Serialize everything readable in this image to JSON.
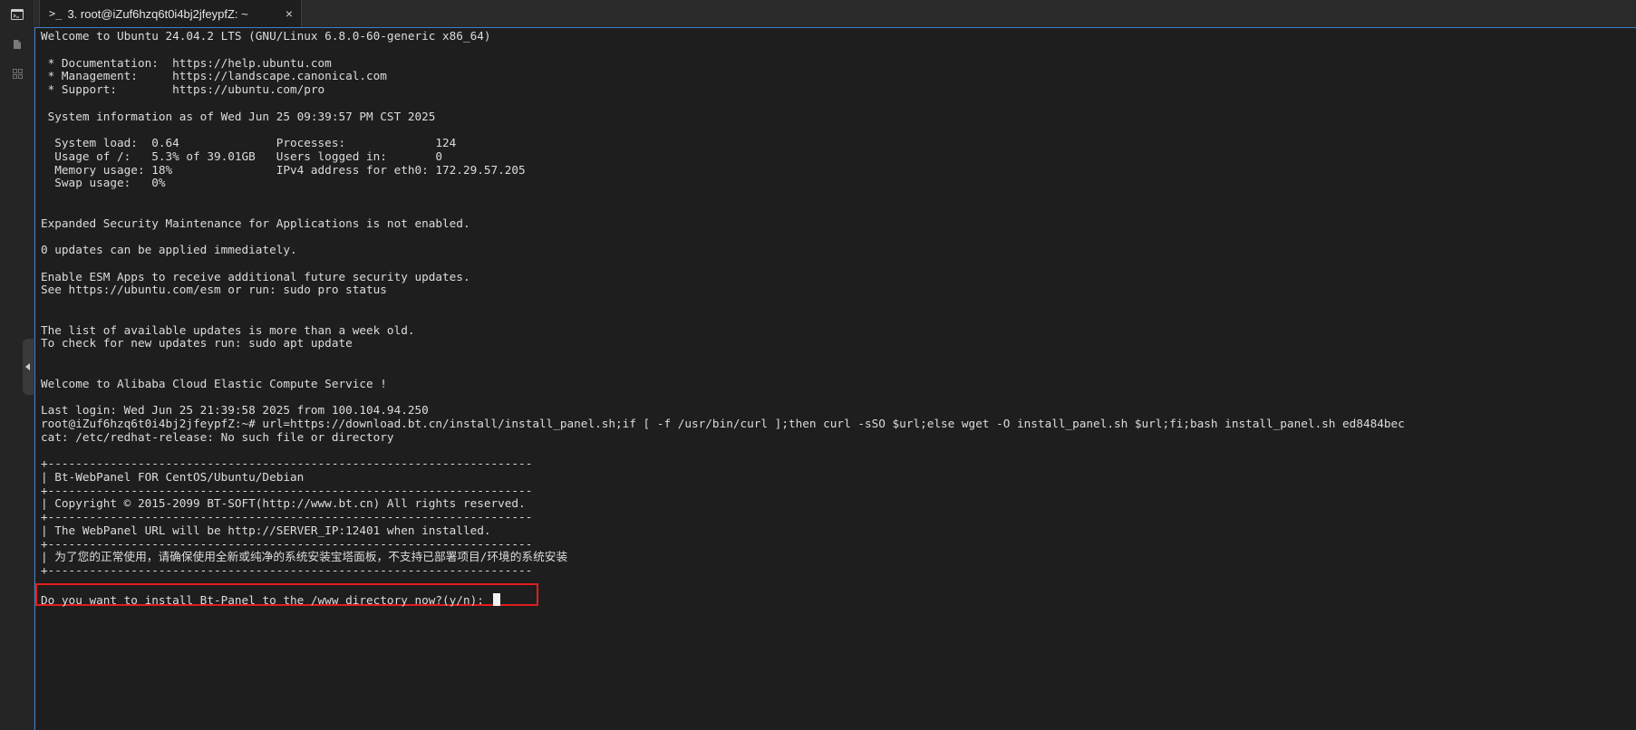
{
  "tab": {
    "icon": ">_",
    "title": "3. root@iZuf6hzq6t0i4bj2jfeypfZ: ~",
    "close": "×"
  },
  "sidebar": {
    "icons": [
      "terminal-icon",
      "file-icon",
      "grid-icon"
    ]
  },
  "terminal": {
    "lines": [
      "Welcome to Ubuntu 24.04.2 LTS (GNU/Linux 6.8.0-60-generic x86_64)",
      "",
      " * Documentation:  https://help.ubuntu.com",
      " * Management:     https://landscape.canonical.com",
      " * Support:        https://ubuntu.com/pro",
      "",
      " System information as of Wed Jun 25 09:39:57 PM CST 2025",
      "",
      "  System load:  0.64              Processes:             124",
      "  Usage of /:   5.3% of 39.01GB   Users logged in:       0",
      "  Memory usage: 18%               IPv4 address for eth0: 172.29.57.205",
      "  Swap usage:   0%",
      "",
      "",
      "Expanded Security Maintenance for Applications is not enabled.",
      "",
      "0 updates can be applied immediately.",
      "",
      "Enable ESM Apps to receive additional future security updates.",
      "See https://ubuntu.com/esm or run: sudo pro status",
      "",
      "",
      "The list of available updates is more than a week old.",
      "To check for new updates run: sudo apt update",
      "",
      "",
      "Welcome to Alibaba Cloud Elastic Compute Service !",
      "",
      "Last login: Wed Jun 25 21:39:58 2025 from 100.104.94.250",
      "root@iZuf6hzq6t0i4bj2jfeypfZ:~# url=https://download.bt.cn/install/install_panel.sh;if [ -f /usr/bin/curl ];then curl -sSO $url;else wget -O install_panel.sh $url;fi;bash install_panel.sh ed8484bec",
      "cat: /etc/redhat-release: No such file or directory",
      "",
      "+----------------------------------------------------------------------",
      "| Bt-WebPanel FOR CentOS/Ubuntu/Debian",
      "+----------------------------------------------------------------------",
      "| Copyright © 2015-2099 BT-SOFT(http://www.bt.cn) All rights reserved.",
      "+----------------------------------------------------------------------",
      "| The WebPanel URL will be http://SERVER_IP:12401 when installed.",
      "+----------------------------------------------------------------------",
      "| 为了您的正常使用，请确保使用全新或纯净的系统安装宝塔面板，不支持已部署项目/环境的系统安装",
      "+----------------------------------------------------------------------",
      ""
    ],
    "prompt": "Do you want to install Bt-Panel to the /www directory now?(y/n): "
  },
  "colors": {
    "background": "#1e1e1e",
    "text": "#dcdcdc",
    "highlight": "#e11d1d",
    "accent": "#3d7fc6"
  }
}
